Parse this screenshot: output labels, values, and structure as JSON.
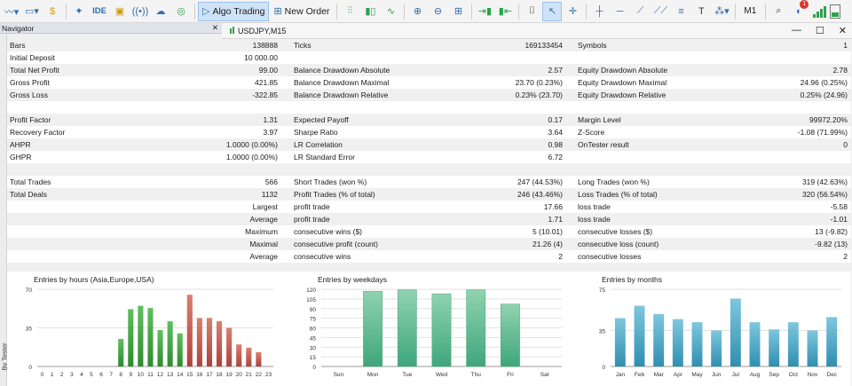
{
  "toolbar": {
    "algo_trading_label": "Algo Trading",
    "new_order_label": "New Order",
    "ide_label": "IDE",
    "timeframe_label": "M1",
    "notification_count": "1"
  },
  "navigator": {
    "title": "Navigator",
    "close": "✕"
  },
  "chart_tab": {
    "symbol_label": "USDJPY,M15"
  },
  "left_strip_label": "By Tester",
  "report": {
    "rows": [
      {
        "c1l": "Bars",
        "c1v": "138888",
        "c2l": "Ticks",
        "c2v": "169133454",
        "c3l": "Symbols",
        "c3v": "1"
      },
      {
        "c1l": "Initial Deposit",
        "c1v": "10 000.00",
        "c2l": "",
        "c2v": "",
        "c3l": "",
        "c3v": ""
      },
      {
        "c1l": "Total Net Profit",
        "c1v": "99.00",
        "c2l": "Balance Drawdown Absolute",
        "c2v": "2.57",
        "c3l": "Equity Drawdown Absolute",
        "c3v": "2.78"
      },
      {
        "c1l": "Gross Profit",
        "c1v": "421.85",
        "c2l": "Balance Drawdown Maximal",
        "c2v": "23.70 (0.23%)",
        "c3l": "Equity Drawdown Maximal",
        "c3v": "24.96 (0.25%)"
      },
      {
        "c1l": "Gross Loss",
        "c1v": "-322.85",
        "c2l": "Balance Drawdown Relative",
        "c2v": "0.23% (23.70)",
        "c3l": "Equity Drawdown Relative",
        "c3v": "0.25% (24.96)"
      },
      {
        "c1l": "",
        "c1v": "",
        "c2l": "",
        "c2v": "",
        "c3l": "",
        "c3v": ""
      },
      {
        "c1l": "Profit Factor",
        "c1v": "1.31",
        "c2l": "Expected Payoff",
        "c2v": "0.17",
        "c3l": "Margin Level",
        "c3v": "99972.20%"
      },
      {
        "c1l": "Recovery Factor",
        "c1v": "3.97",
        "c2l": "Sharpe Ratio",
        "c2v": "3.64",
        "c3l": "Z-Score",
        "c3v": "-1.08 (71.99%)"
      },
      {
        "c1l": "AHPR",
        "c1v": "1.0000 (0.00%)",
        "c2l": "LR Correlation",
        "c2v": "0.98",
        "c3l": "OnTester result",
        "c3v": "0"
      },
      {
        "c1l": "GHPR",
        "c1v": "1.0000 (0.00%)",
        "c2l": "LR Standard Error",
        "c2v": "6.72",
        "c3l": "",
        "c3v": ""
      },
      {
        "c1l": "",
        "c1v": "",
        "c2l": "",
        "c2v": "",
        "c3l": "",
        "c3v": ""
      },
      {
        "c1l": "Total Trades",
        "c1v": "566",
        "c2l": "Short Trades (won %)",
        "c2v": "247 (44.53%)",
        "c3l": "Long Trades (won %)",
        "c3v": "319 (42.63%)"
      },
      {
        "c1l": "Total Deals",
        "c1v": "1132",
        "c2l": "Profit Trades (% of total)",
        "c2v": "246 (43.46%)",
        "c3l": "Loss Trades (% of total)",
        "c3v": "320 (56.54%)"
      },
      {
        "c1l": "",
        "c1v": "Largest",
        "c2l": "profit trade",
        "c2v": "17.66",
        "c3l": "loss trade",
        "c3v": "-5.58"
      },
      {
        "c1l": "",
        "c1v": "Average",
        "c2l": "profit trade",
        "c2v": "1.71",
        "c3l": "loss trade",
        "c3v": "-1.01"
      },
      {
        "c1l": "",
        "c1v": "Maximum",
        "c2l": "consecutive wins ($)",
        "c2v": "5 (10.01)",
        "c3l": "consecutive losses ($)",
        "c3v": "13 (-9.82)"
      },
      {
        "c1l": "",
        "c1v": "Maximal",
        "c2l": "consecutive profit (count)",
        "c2v": "21.26 (4)",
        "c3l": "consecutive loss (count)",
        "c3v": "-9.82 (13)"
      },
      {
        "c1l": "",
        "c1v": "Average",
        "c2l": "consecutive wins",
        "c2v": "2",
        "c3l": "consecutive losses",
        "c3v": "2"
      }
    ]
  },
  "colors": {
    "hours_win": "#2e8b2e",
    "hours_loss": "#b0413a",
    "weekdays": "#3fa77a",
    "months": "#2f8fb0"
  },
  "chart_data": [
    {
      "type": "bar",
      "title": "Entries by hours (Asia,Europe,USA)",
      "categories": [
        "0",
        "1",
        "2",
        "3",
        "4",
        "5",
        "6",
        "7",
        "8",
        "9",
        "10",
        "11",
        "12",
        "13",
        "14",
        "15",
        "16",
        "17",
        "18",
        "19",
        "20",
        "21",
        "22",
        "23"
      ],
      "values": [
        0,
        0,
        0,
        0,
        0,
        0,
        0,
        0,
        25,
        52,
        55,
        53,
        33,
        41,
        30,
        65,
        44,
        44,
        41,
        35,
        20,
        17,
        13,
        0
      ],
      "ylim": [
        0,
        70
      ],
      "yticks": [
        "70",
        "35",
        "0"
      ],
      "ytick_values": [
        70,
        35,
        0
      ]
    },
    {
      "type": "bar",
      "title": "Entries by weekdays",
      "categories": [
        "Sun",
        "Mon",
        "Tue",
        "Wed",
        "Thu",
        "Fri",
        "Sat"
      ],
      "values": [
        0,
        117,
        119,
        113,
        119,
        97,
        0
      ],
      "ylim": [
        0,
        120
      ],
      "yticks": [
        "120",
        "105",
        "90",
        "75",
        "60",
        "45",
        "30",
        "15",
        "0"
      ],
      "ytick_values": [
        120,
        105,
        90,
        75,
        60,
        45,
        30,
        15,
        0
      ]
    },
    {
      "type": "bar",
      "title": "Entries by months",
      "categories": [
        "Jan",
        "Feb",
        "Mar",
        "Apr",
        "May",
        "Jun",
        "Jul",
        "Aug",
        "Sep",
        "Oct",
        "Nov",
        "Dec"
      ],
      "values": [
        47,
        59,
        51,
        46,
        43,
        35,
        66,
        43,
        36,
        43,
        35,
        48
      ],
      "ylim": [
        0,
        75
      ],
      "yticks": [
        "75",
        "35",
        "0"
      ],
      "ytick_values": [
        75,
        35,
        0
      ]
    }
  ]
}
